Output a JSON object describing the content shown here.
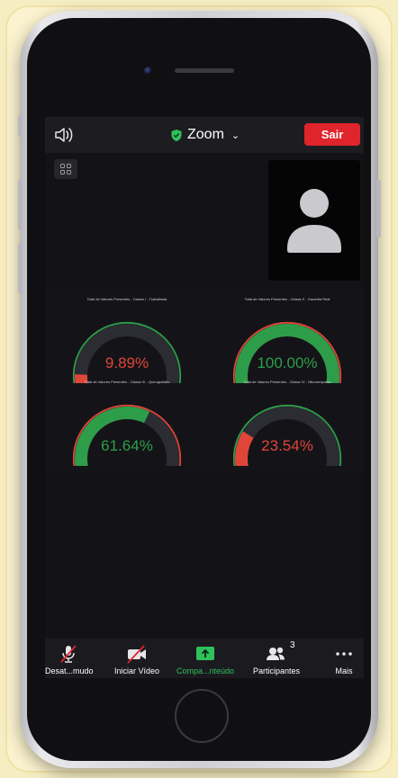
{
  "header": {
    "title": "Zoom",
    "leave_label": "Sair"
  },
  "colors": {
    "accent_red": "#e0242c",
    "secure_green": "#2fc15c",
    "gauge_green": "#2e9d4a",
    "gauge_red": "#e0453a"
  },
  "icons": [
    "speaker-icon",
    "shield-check-icon",
    "chevron-down-icon",
    "gallery-grid-icon",
    "avatar-icon",
    "microphone-muted-icon",
    "video-off-icon",
    "share-arrow-icon",
    "participants-icon",
    "more-icon"
  ],
  "gauges": [
    {
      "title": "Total de Valores Presentes - Classe I - Trabalhista",
      "value_label": "9.89%",
      "value": 9.89,
      "color": "red"
    },
    {
      "title": "Total de Valores Presentes - Classe II - Garantia Real",
      "value_label": "100.00%",
      "value": 100.0,
      "color": "green"
    },
    {
      "title": "Total de Valores Presentes - Classe III - Quirografário",
      "value_label": "61.64%",
      "value": 61.64,
      "color": "green"
    },
    {
      "title": "Total de Valores Presentes - Classe IV - Microempresa",
      "value_label": "23.54%",
      "value": 23.54,
      "color": "red"
    }
  ],
  "toolbar": {
    "mute_label": "Desat...mudo",
    "video_label": "Iniciar Vídeo",
    "share_label": "Compa...nteúdo",
    "participants_label": "Participantes",
    "participants_count": "3",
    "more_label": "Mais"
  }
}
